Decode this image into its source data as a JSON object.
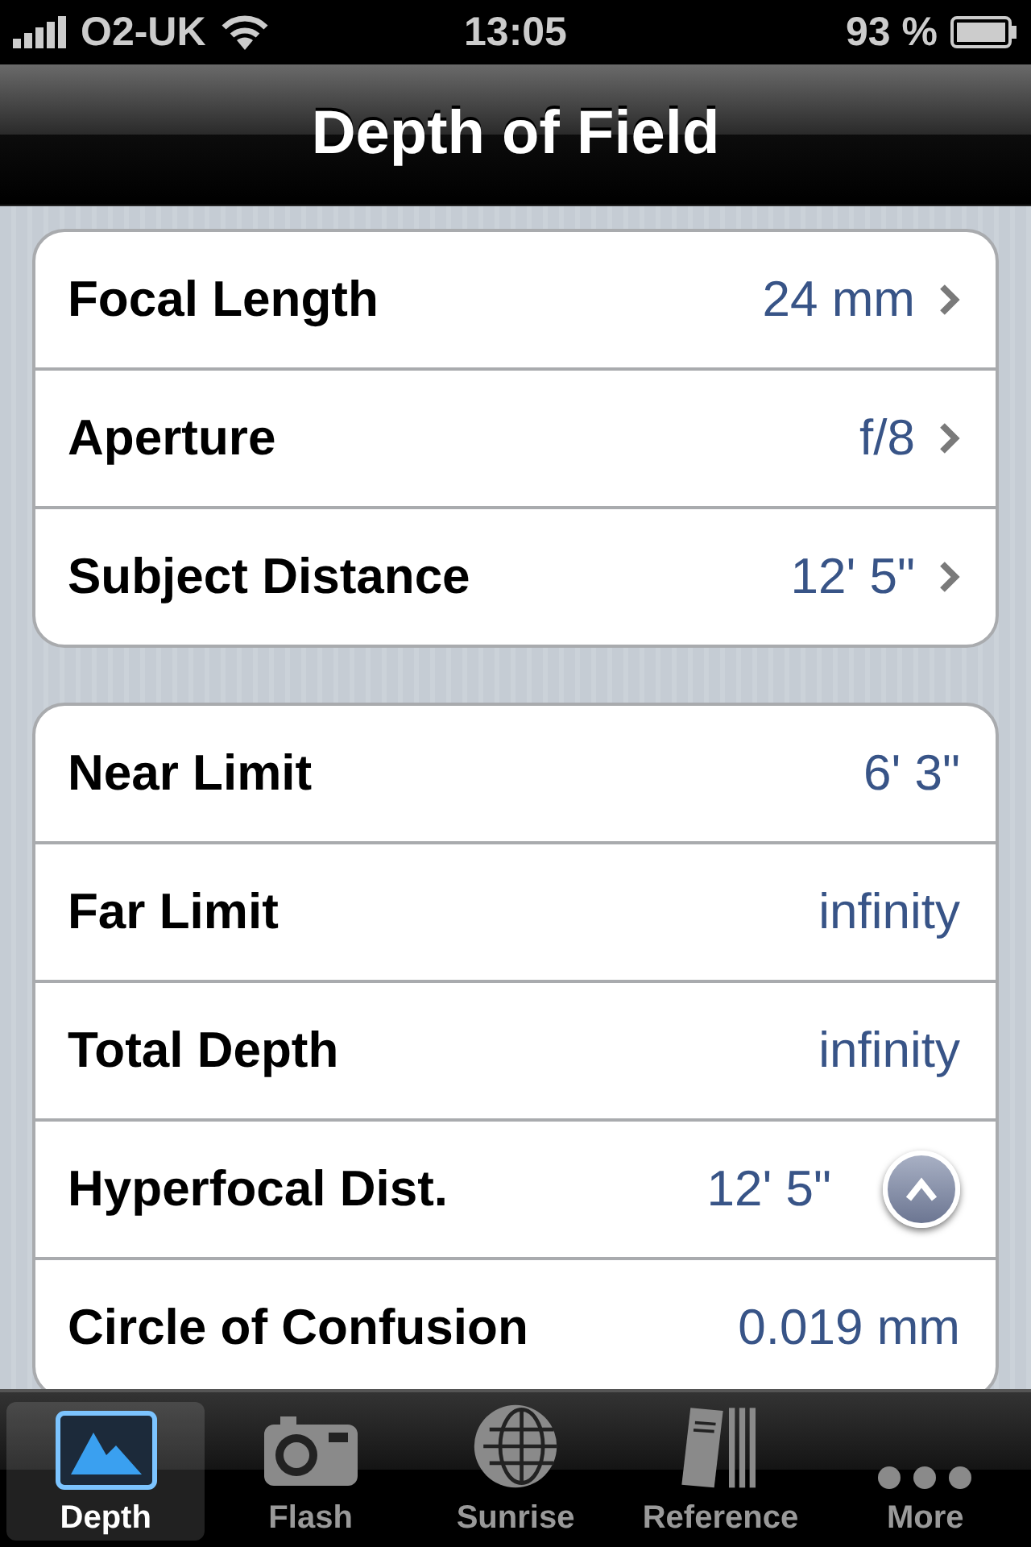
{
  "status_bar": {
    "carrier": "O2-UK",
    "time": "13:05",
    "battery": "93 %"
  },
  "nav_bar": {
    "title": "Depth of Field"
  },
  "groups": [
    {
      "rows": [
        {
          "kind": "disclosure",
          "label": "Focal Length",
          "value": "24 mm"
        },
        {
          "kind": "disclosure",
          "label": "Aperture",
          "value": "f/8"
        },
        {
          "kind": "disclosure",
          "label": "Subject Distance",
          "value": "12' 5\""
        }
      ]
    },
    {
      "rows": [
        {
          "kind": "value",
          "label": "Near Limit",
          "value": "6' 3\""
        },
        {
          "kind": "value",
          "label": "Far Limit",
          "value": "infinity"
        },
        {
          "kind": "value",
          "label": "Total Depth",
          "value": "infinity"
        },
        {
          "kind": "detail",
          "label": "Hyperfocal Dist.",
          "value": "12' 5\""
        },
        {
          "kind": "value",
          "label": "Circle of Confusion",
          "value": "0.019 mm"
        }
      ]
    }
  ],
  "tab_bar": [
    {
      "label": "Depth",
      "selected": true
    },
    {
      "label": "Flash",
      "selected": false
    },
    {
      "label": "Sunrise",
      "selected": false
    },
    {
      "label": "Reference",
      "selected": false
    },
    {
      "label": "More",
      "selected": false
    }
  ]
}
